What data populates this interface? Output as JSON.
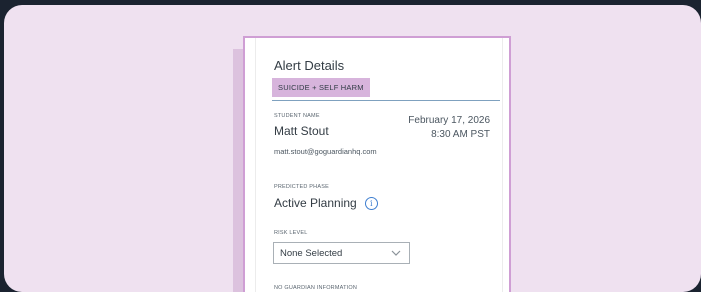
{
  "alert_details": {
    "title": "Alert Details",
    "category_badge": "SUICIDE + SELF HARM",
    "student": {
      "label": "STUDENT NAME",
      "name": "Matt Stout",
      "email": "matt.stout@goguardianhq.com"
    },
    "timestamp": {
      "date": "February 17, 2026",
      "time": "8:30 AM PST"
    },
    "predicted_phase": {
      "label": "PREDICTED PHASE",
      "value": "Active Planning",
      "icon": "info-icon"
    },
    "risk_level": {
      "label": "RISK LEVEL",
      "selected": "None Selected",
      "icon": "chevron-down-icon"
    },
    "guardian": {
      "label": "NO GUARDIAN INFORMATION"
    }
  },
  "colors": {
    "background_dark": "#1b2330",
    "card_lilac": "#efe1f0",
    "panel_border": "#cf9ed4",
    "badge": "#d7b4dc",
    "divider_blue": "#7fa1bf",
    "info_blue": "#3f7fd0"
  }
}
